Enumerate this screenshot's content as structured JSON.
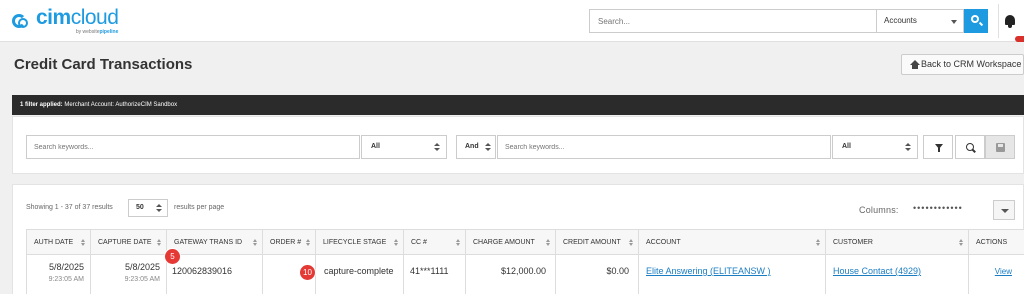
{
  "brand": {
    "name_bold": "cim",
    "name_light": "cloud",
    "tagline_prefix": "by website",
    "tagline_brand": "pipeline"
  },
  "topbar": {
    "search_placeholder": "Search...",
    "scope_select": "Accounts",
    "colors": {
      "accent": "#1e9be0",
      "notification": "#d9302b"
    }
  },
  "page": {
    "title": "Credit Card Transactions",
    "back_button": "Back to CRM Workspace"
  },
  "filter_bar": {
    "prefix": "1 filter applied:",
    "text": "Merchant Account: AuthorizeCIM Sandbox"
  },
  "search": {
    "keywords1_placeholder": "Search keywords...",
    "field1": "All",
    "conjunction": "And",
    "keywords2_placeholder": "Search keywords...",
    "field2": "All"
  },
  "results": {
    "showing": "Showing 1 - 37 of 37 results",
    "per_page": "50",
    "per_page_label": "results per page",
    "columns_label": "Columns:",
    "columns_dots": "••••••••••••"
  },
  "table": {
    "headers": [
      "AUTH DATE",
      "CAPTURE DATE",
      "GATEWAY TRANS ID",
      "ORDER #",
      "LIFECYCLE STAGE",
      "CC #",
      "CHARGE AMOUNT",
      "CREDIT AMOUNT",
      "ACCOUNT",
      "CUSTOMER",
      "ACTIONS"
    ],
    "rows": [
      {
        "auth_date": "5/8/2025",
        "auth_time": "9:23:05 AM",
        "capture_date": "5/8/2025",
        "capture_time": "9:23:05 AM",
        "gateway_trans_id": "120062839016",
        "order_num": "",
        "lifecycle_stage": "capture-complete",
        "cc_num": "41***1111",
        "charge_amount": "$12,000.00",
        "credit_amount": "$0.00",
        "account": "Elite Answering (ELITEANSW )",
        "customer": "House Contact (4929)",
        "action": "View"
      }
    ]
  },
  "annotations": {
    "badge_a": "5",
    "badge_b": "10",
    "color": "#e53935"
  }
}
